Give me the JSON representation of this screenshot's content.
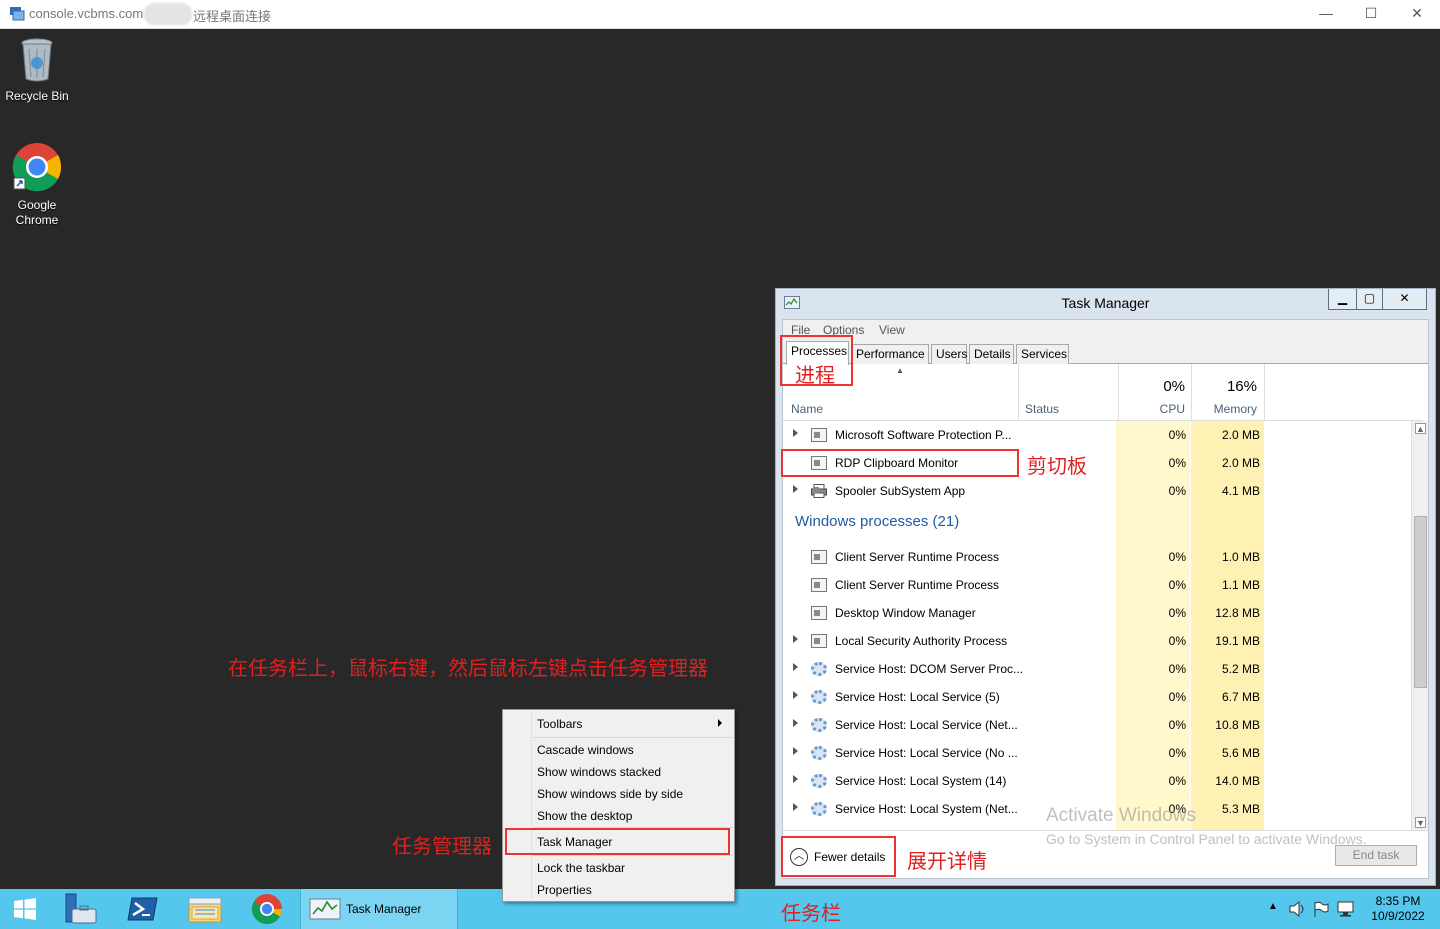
{
  "rdp": {
    "host": "console.vcbms.com",
    "title": "远程桌面连接",
    "minimize_glyph": "—",
    "maximize_glyph": "☐",
    "close_glyph": "✕"
  },
  "desktop": {
    "icons": [
      {
        "label": "Recycle Bin",
        "icon": "recycle-bin-icon"
      },
      {
        "label": "Google Chrome",
        "icon": "chrome-icon"
      }
    ]
  },
  "task_manager": {
    "title": "Task Manager",
    "title_buttons": {
      "minimize": "▁",
      "maximize": "▢",
      "close": "✕"
    },
    "menu": [
      "File",
      "Options",
      "View"
    ],
    "tabs": [
      "Processes",
      "Performance",
      "Users",
      "Details",
      "Services"
    ],
    "active_tab": "Processes",
    "columns": {
      "name": "Name",
      "status": "Status",
      "cpu_pct": "0%",
      "cpu_label": "CPU",
      "mem_pct": "16%",
      "mem_label": "Memory"
    },
    "app_rows": [
      {
        "name": "Microsoft Software Protection P...",
        "cpu": "0%",
        "mem": "2.0 MB",
        "expandable": true,
        "icon": "window"
      },
      {
        "name": "RDP Clipboard Monitor",
        "cpu": "0%",
        "mem": "2.0 MB",
        "expandable": false,
        "icon": "window"
      },
      {
        "name": "Spooler SubSystem App",
        "cpu": "0%",
        "mem": "4.1 MB",
        "expandable": true,
        "icon": "printer"
      }
    ],
    "group_title": "Windows processes (21)",
    "win_rows": [
      {
        "name": "Client Server Runtime Process",
        "cpu": "0%",
        "mem": "1.0 MB",
        "expandable": false,
        "icon": "window"
      },
      {
        "name": "Client Server Runtime Process",
        "cpu": "0%",
        "mem": "1.1 MB",
        "expandable": false,
        "icon": "window"
      },
      {
        "name": "Desktop Window Manager",
        "cpu": "0%",
        "mem": "12.8 MB",
        "expandable": false,
        "icon": "window"
      },
      {
        "name": "Local Security Authority Process",
        "cpu": "0%",
        "mem": "19.1 MB",
        "expandable": true,
        "icon": "window"
      },
      {
        "name": "Service Host: DCOM Server Proc...",
        "cpu": "0%",
        "mem": "5.2 MB",
        "expandable": true,
        "icon": "gear"
      },
      {
        "name": "Service Host: Local Service (5)",
        "cpu": "0%",
        "mem": "6.7 MB",
        "expandable": true,
        "icon": "gear"
      },
      {
        "name": "Service Host: Local Service (Net...",
        "cpu": "0%",
        "mem": "10.8 MB",
        "expandable": true,
        "icon": "gear"
      },
      {
        "name": "Service Host: Local Service (No ...",
        "cpu": "0%",
        "mem": "5.6 MB",
        "expandable": true,
        "icon": "gear"
      },
      {
        "name": "Service Host: Local System (14)",
        "cpu": "0%",
        "mem": "14.0 MB",
        "expandable": true,
        "icon": "gear"
      },
      {
        "name": "Service Host: Local System (Net...",
        "cpu": "0%",
        "mem": "5.3 MB",
        "expandable": true,
        "icon": "gear"
      }
    ],
    "fewer_details": "Fewer details",
    "end_task": "End task"
  },
  "watermark": {
    "line1": "Activate Windows",
    "line2": "Go to System in Control Panel to activate Windows."
  },
  "context_menu": {
    "items": [
      "Toolbars",
      "Cascade windows",
      "Show windows stacked",
      "Show windows side by side",
      "Show the desktop",
      "Task Manager",
      "Lock the taskbar",
      "Properties"
    ]
  },
  "taskbar": {
    "pinned": [
      "start-icon",
      "server-manager-icon",
      "powershell-icon",
      "file-explorer-icon",
      "chrome-icon"
    ],
    "active_app": "Task Manager",
    "time": "8:35 PM",
    "date": "10/9/2022"
  },
  "annotations": {
    "processes": "进程",
    "clipboard": "剪切板",
    "instruction": "在任务栏上，鼠标右键，然后鼠标左键点击任务管理器",
    "task_manager": "任务管理器",
    "expand_details": "展开详情",
    "taskbar": "任务栏"
  },
  "colors": {
    "desktop_bg": "#282828",
    "taskbar_bg": "#55c6ec",
    "annotation_red": "#e02020",
    "group_title_blue": "#1e5da6",
    "cpu_band": "#fff8cc",
    "memory_band": "#fff1b3"
  }
}
